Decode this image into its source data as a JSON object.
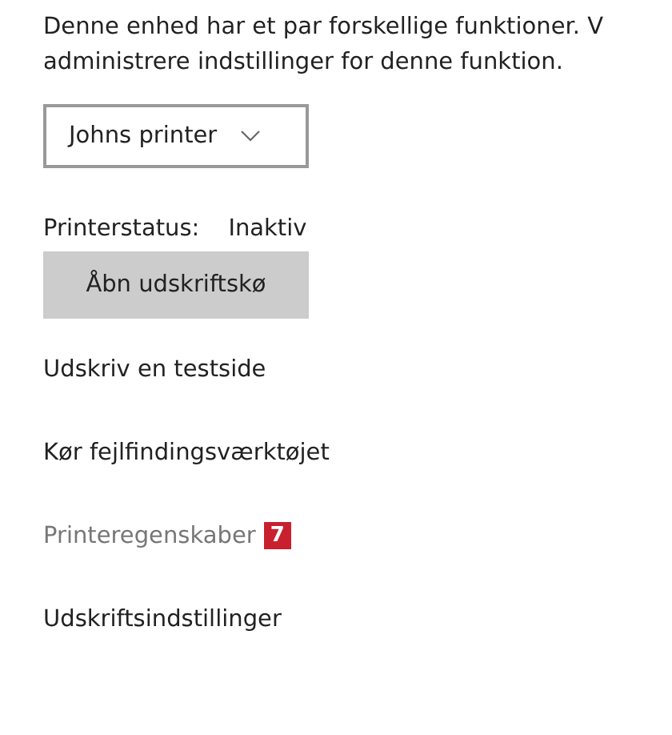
{
  "description": [
    "Denne enhed har et par forskellige funktioner. V",
    "administrere indstillinger for denne funktion."
  ],
  "device_dropdown": {
    "value": "Johns printer"
  },
  "status": {
    "label": "Printerstatus:",
    "value": "Inaktiv"
  },
  "open_queue_button": "Åbn udskriftskø",
  "links": [
    {
      "label": "Udskriv en testside",
      "disabled": false
    },
    {
      "label": "Kør fejlfindingsværktøjet",
      "disabled": false
    },
    {
      "label": "Printeregenskaber",
      "disabled": true,
      "badge": {
        "text": "7",
        "color": "#c8202f"
      }
    },
    {
      "label": "Udskriftsindstillinger",
      "disabled": false
    }
  ]
}
